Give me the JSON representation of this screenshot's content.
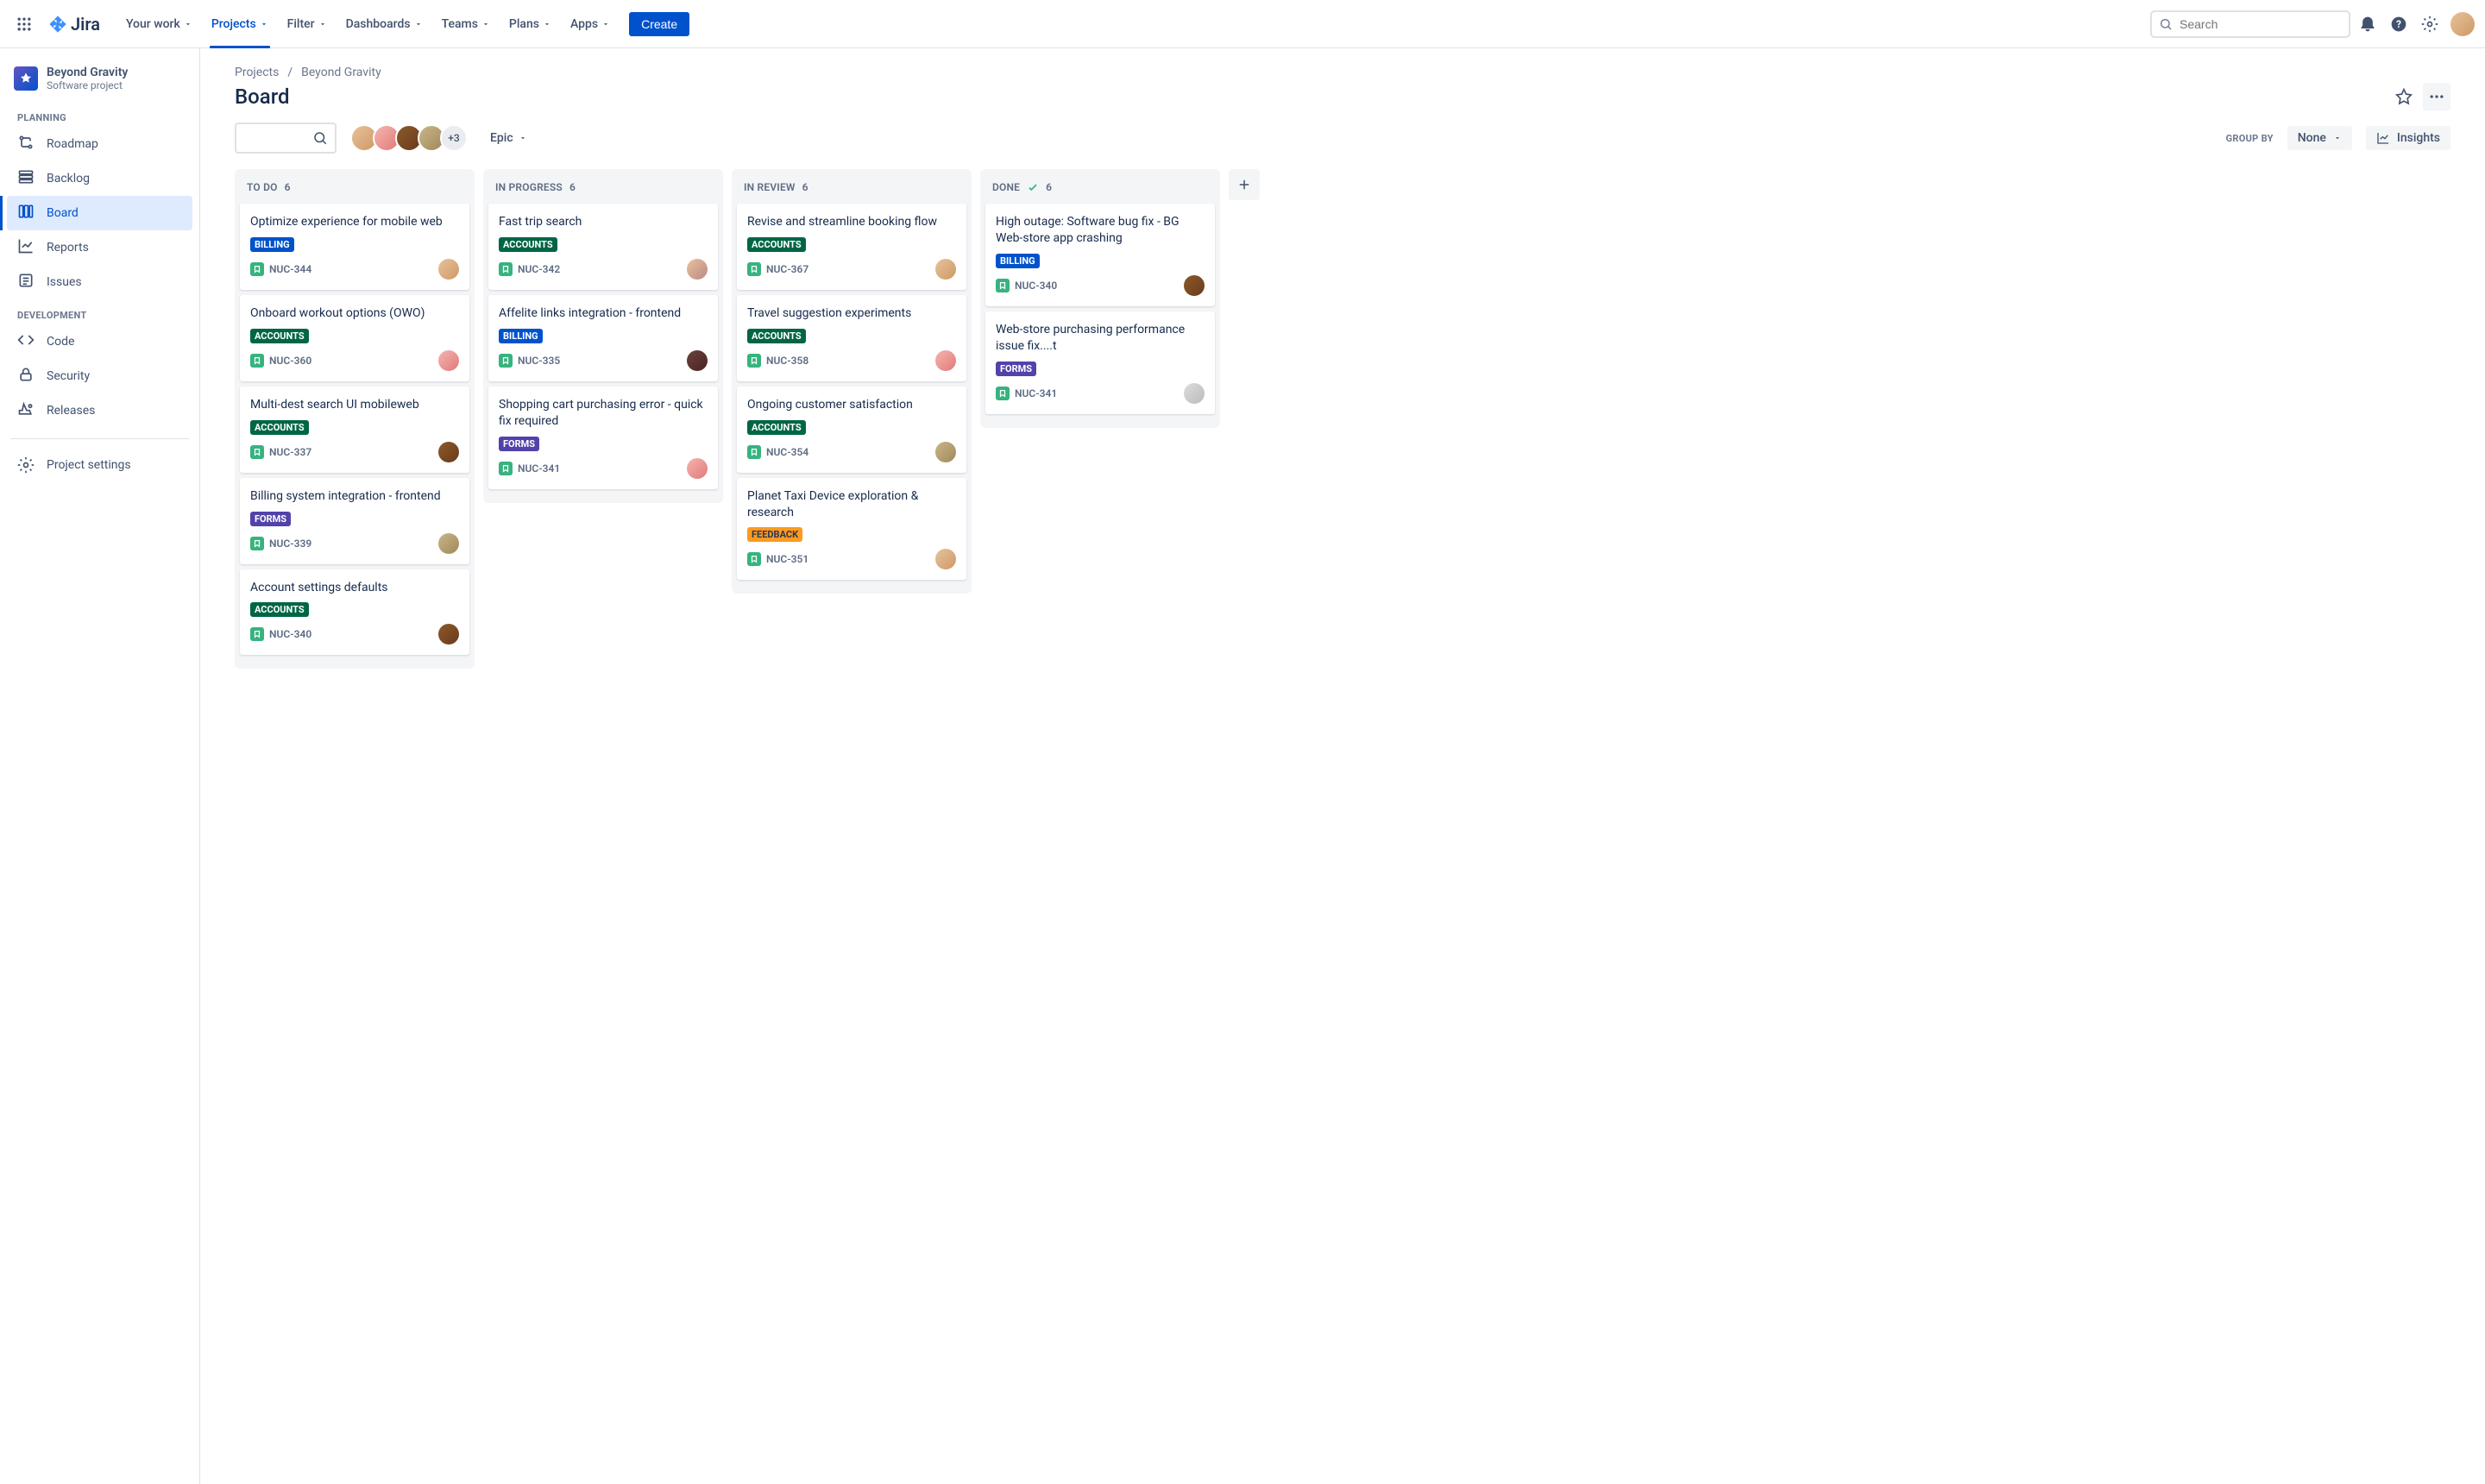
{
  "app": {
    "name": "Jira"
  },
  "topnav": {
    "items": [
      {
        "label": "Your work"
      },
      {
        "label": "Projects"
      },
      {
        "label": "Filter"
      },
      {
        "label": "Dashboards"
      },
      {
        "label": "Teams"
      },
      {
        "label": "Plans"
      },
      {
        "label": "Apps"
      }
    ],
    "active_index": 1,
    "create_label": "Create",
    "search_placeholder": "Search"
  },
  "sidebar": {
    "project": {
      "name": "Beyond Gravity",
      "type": "Software project"
    },
    "sections": [
      {
        "label": "PLANNING",
        "items": [
          {
            "label": "Roadmap",
            "icon": "roadmap"
          },
          {
            "label": "Backlog",
            "icon": "backlog"
          },
          {
            "label": "Board",
            "icon": "board"
          },
          {
            "label": "Reports",
            "icon": "reports"
          },
          {
            "label": "Issues",
            "icon": "issues"
          }
        ],
        "active_index": 2
      },
      {
        "label": "DEVELOPMENT",
        "items": [
          {
            "label": "Code",
            "icon": "code"
          },
          {
            "label": "Security",
            "icon": "security"
          },
          {
            "label": "Releases",
            "icon": "releases"
          }
        ]
      }
    ],
    "settings_label": "Project settings"
  },
  "breadcrumbs": [
    "Projects",
    "Beyond Gravity"
  ],
  "page_title": "Board",
  "toolbar": {
    "avatars_extra": "+3",
    "epic_label": "Epic",
    "group_by_label": "GROUP BY",
    "group_by_value": "None",
    "insights_label": "Insights"
  },
  "epic_colors": {
    "BILLING": "#0052CC",
    "ACCOUNTS": "#006644",
    "FORMS": "#5243AA",
    "FEEDBACK": "#FF991F"
  },
  "columns": [
    {
      "name": "TO DO",
      "count": "6",
      "cards": [
        {
          "title": "Optimize experience for mobile web",
          "epic": "BILLING",
          "key": "NUC-344",
          "av": 0
        },
        {
          "title": "Onboard workout options (OWO)",
          "epic": "ACCOUNTS",
          "key": "NUC-360",
          "av": 1
        },
        {
          "title": "Multi-dest search UI mobileweb",
          "epic": "ACCOUNTS",
          "key": "NUC-337",
          "av": 2
        },
        {
          "title": "Billing system integration - frontend",
          "epic": "FORMS",
          "key": "NUC-339",
          "av": 3
        },
        {
          "title": "Account settings defaults",
          "epic": "ACCOUNTS",
          "key": "NUC-340",
          "av": 2
        }
      ]
    },
    {
      "name": "IN PROGRESS",
      "count": "6",
      "cards": [
        {
          "title": "Fast trip search",
          "epic": "ACCOUNTS",
          "key": "NUC-342",
          "av": 5
        },
        {
          "title": "Affelite links integration - frontend",
          "epic": "BILLING",
          "key": "NUC-335",
          "av": 4
        },
        {
          "title": "Shopping cart purchasing error - quick fix required",
          "epic": "FORMS",
          "key": "NUC-341",
          "av": 1
        }
      ]
    },
    {
      "name": "IN REVIEW",
      "count": "6",
      "cards": [
        {
          "title": "Revise and streamline booking flow",
          "epic": "ACCOUNTS",
          "key": "NUC-367",
          "av": 0
        },
        {
          "title": "Travel suggestion experiments",
          "epic": "ACCOUNTS",
          "key": "NUC-358",
          "av": 1
        },
        {
          "title": "Ongoing customer satisfaction",
          "epic": "ACCOUNTS",
          "key": "NUC-354",
          "av": 3
        },
        {
          "title": "Planet Taxi Device exploration & research",
          "epic": "FEEDBACK",
          "key": "NUC-351",
          "av": 0
        }
      ]
    },
    {
      "name": "DONE",
      "count": "6",
      "done": true,
      "cards": [
        {
          "title": "High outage: Software bug fix - BG Web-store app crashing",
          "epic": "BILLING",
          "key": "NUC-340",
          "av": 2
        },
        {
          "title": "Web-store purchasing performance issue fix....t",
          "epic": "FORMS",
          "key": "NUC-341",
          "av": 6
        }
      ]
    }
  ]
}
